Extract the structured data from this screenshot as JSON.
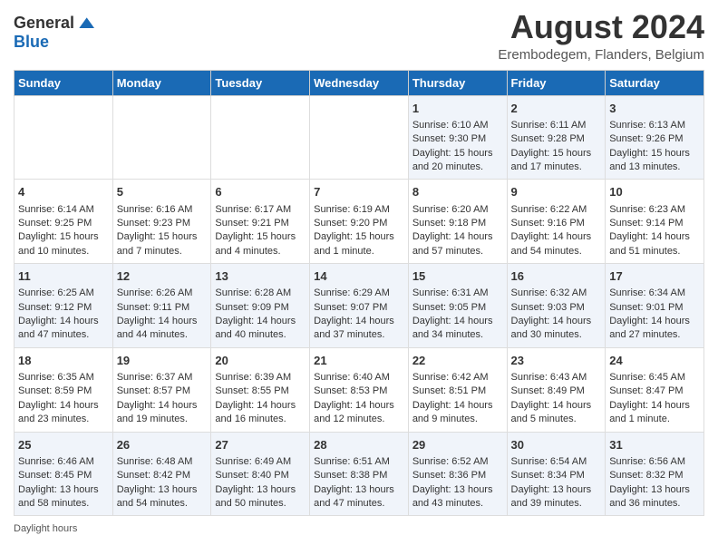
{
  "header": {
    "logo_general": "General",
    "logo_blue": "Blue",
    "title": "August 2024",
    "location": "Erembodegem, Flanders, Belgium"
  },
  "days_of_week": [
    "Sunday",
    "Monday",
    "Tuesday",
    "Wednesday",
    "Thursday",
    "Friday",
    "Saturday"
  ],
  "weeks": [
    [
      {
        "day": "",
        "content": ""
      },
      {
        "day": "",
        "content": ""
      },
      {
        "day": "",
        "content": ""
      },
      {
        "day": "",
        "content": ""
      },
      {
        "day": "1",
        "content": "Sunrise: 6:10 AM\nSunset: 9:30 PM\nDaylight: 15 hours and 20 minutes."
      },
      {
        "day": "2",
        "content": "Sunrise: 6:11 AM\nSunset: 9:28 PM\nDaylight: 15 hours and 17 minutes."
      },
      {
        "day": "3",
        "content": "Sunrise: 6:13 AM\nSunset: 9:26 PM\nDaylight: 15 hours and 13 minutes."
      }
    ],
    [
      {
        "day": "4",
        "content": "Sunrise: 6:14 AM\nSunset: 9:25 PM\nDaylight: 15 hours and 10 minutes."
      },
      {
        "day": "5",
        "content": "Sunrise: 6:16 AM\nSunset: 9:23 PM\nDaylight: 15 hours and 7 minutes."
      },
      {
        "day": "6",
        "content": "Sunrise: 6:17 AM\nSunset: 9:21 PM\nDaylight: 15 hours and 4 minutes."
      },
      {
        "day": "7",
        "content": "Sunrise: 6:19 AM\nSunset: 9:20 PM\nDaylight: 15 hours and 1 minute."
      },
      {
        "day": "8",
        "content": "Sunrise: 6:20 AM\nSunset: 9:18 PM\nDaylight: 14 hours and 57 minutes."
      },
      {
        "day": "9",
        "content": "Sunrise: 6:22 AM\nSunset: 9:16 PM\nDaylight: 14 hours and 54 minutes."
      },
      {
        "day": "10",
        "content": "Sunrise: 6:23 AM\nSunset: 9:14 PM\nDaylight: 14 hours and 51 minutes."
      }
    ],
    [
      {
        "day": "11",
        "content": "Sunrise: 6:25 AM\nSunset: 9:12 PM\nDaylight: 14 hours and 47 minutes."
      },
      {
        "day": "12",
        "content": "Sunrise: 6:26 AM\nSunset: 9:11 PM\nDaylight: 14 hours and 44 minutes."
      },
      {
        "day": "13",
        "content": "Sunrise: 6:28 AM\nSunset: 9:09 PM\nDaylight: 14 hours and 40 minutes."
      },
      {
        "day": "14",
        "content": "Sunrise: 6:29 AM\nSunset: 9:07 PM\nDaylight: 14 hours and 37 minutes."
      },
      {
        "day": "15",
        "content": "Sunrise: 6:31 AM\nSunset: 9:05 PM\nDaylight: 14 hours and 34 minutes."
      },
      {
        "day": "16",
        "content": "Sunrise: 6:32 AM\nSunset: 9:03 PM\nDaylight: 14 hours and 30 minutes."
      },
      {
        "day": "17",
        "content": "Sunrise: 6:34 AM\nSunset: 9:01 PM\nDaylight: 14 hours and 27 minutes."
      }
    ],
    [
      {
        "day": "18",
        "content": "Sunrise: 6:35 AM\nSunset: 8:59 PM\nDaylight: 14 hours and 23 minutes."
      },
      {
        "day": "19",
        "content": "Sunrise: 6:37 AM\nSunset: 8:57 PM\nDaylight: 14 hours and 19 minutes."
      },
      {
        "day": "20",
        "content": "Sunrise: 6:39 AM\nSunset: 8:55 PM\nDaylight: 14 hours and 16 minutes."
      },
      {
        "day": "21",
        "content": "Sunrise: 6:40 AM\nSunset: 8:53 PM\nDaylight: 14 hours and 12 minutes."
      },
      {
        "day": "22",
        "content": "Sunrise: 6:42 AM\nSunset: 8:51 PM\nDaylight: 14 hours and 9 minutes."
      },
      {
        "day": "23",
        "content": "Sunrise: 6:43 AM\nSunset: 8:49 PM\nDaylight: 14 hours and 5 minutes."
      },
      {
        "day": "24",
        "content": "Sunrise: 6:45 AM\nSunset: 8:47 PM\nDaylight: 14 hours and 1 minute."
      }
    ],
    [
      {
        "day": "25",
        "content": "Sunrise: 6:46 AM\nSunset: 8:45 PM\nDaylight: 13 hours and 58 minutes."
      },
      {
        "day": "26",
        "content": "Sunrise: 6:48 AM\nSunset: 8:42 PM\nDaylight: 13 hours and 54 minutes."
      },
      {
        "day": "27",
        "content": "Sunrise: 6:49 AM\nSunset: 8:40 PM\nDaylight: 13 hours and 50 minutes."
      },
      {
        "day": "28",
        "content": "Sunrise: 6:51 AM\nSunset: 8:38 PM\nDaylight: 13 hours and 47 minutes."
      },
      {
        "day": "29",
        "content": "Sunrise: 6:52 AM\nSunset: 8:36 PM\nDaylight: 13 hours and 43 minutes."
      },
      {
        "day": "30",
        "content": "Sunrise: 6:54 AM\nSunset: 8:34 PM\nDaylight: 13 hours and 39 minutes."
      },
      {
        "day": "31",
        "content": "Sunrise: 6:56 AM\nSunset: 8:32 PM\nDaylight: 13 hours and 36 minutes."
      }
    ]
  ],
  "footer": {
    "daylight_label": "Daylight hours"
  }
}
